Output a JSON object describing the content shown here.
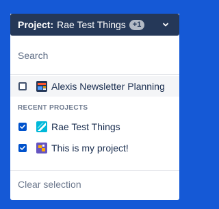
{
  "header": {
    "title_prefix": "Project:",
    "title_name": "Rae Test Things",
    "badge": "+1"
  },
  "search": {
    "placeholder": "Search"
  },
  "results": [
    {
      "label": "Alexis Newsletter Planning",
      "checked": false,
      "icon": "newsletter-project-icon"
    }
  ],
  "recent": {
    "heading": "RECENT PROJECTS",
    "items": [
      {
        "label": "Rae Test Things",
        "checked": true,
        "icon": "rae-test-project-icon"
      },
      {
        "label": "This is my project!",
        "checked": true,
        "icon": "my-project-icon"
      }
    ]
  },
  "footer": {
    "clear_label": "Clear selection"
  },
  "colors": {
    "background": "#1559d6",
    "header": "#253858",
    "checkbox_checked": "#0052cc"
  }
}
